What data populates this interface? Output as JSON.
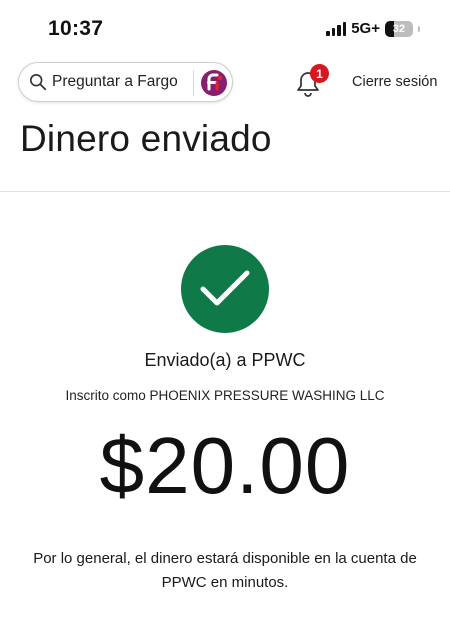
{
  "status_bar": {
    "time": "10:37",
    "network": "5G+",
    "battery": "32"
  },
  "header": {
    "search_placeholder": "Preguntar a Fargo",
    "notification_count": "1",
    "signout_label": "Cierre sesión"
  },
  "page": {
    "title": "Dinero enviado"
  },
  "confirmation": {
    "sent_to": "Enviado(a) a PPWC",
    "enrolled_as": "Inscrito como PHOENIX PRESSURE WASHING LLC",
    "amount": "$20.00",
    "note": "Por lo general, el dinero estará disponible en la cuenta de PPWC en minutos."
  },
  "colors": {
    "success_green": "#0f7a47",
    "badge_red": "#d7161e",
    "fargo_purple": "#8a1e6e"
  },
  "icons": {
    "search": "search-icon",
    "assistant": "fargo-logo-icon",
    "notifications": "bell-icon",
    "success": "checkmark-icon"
  }
}
